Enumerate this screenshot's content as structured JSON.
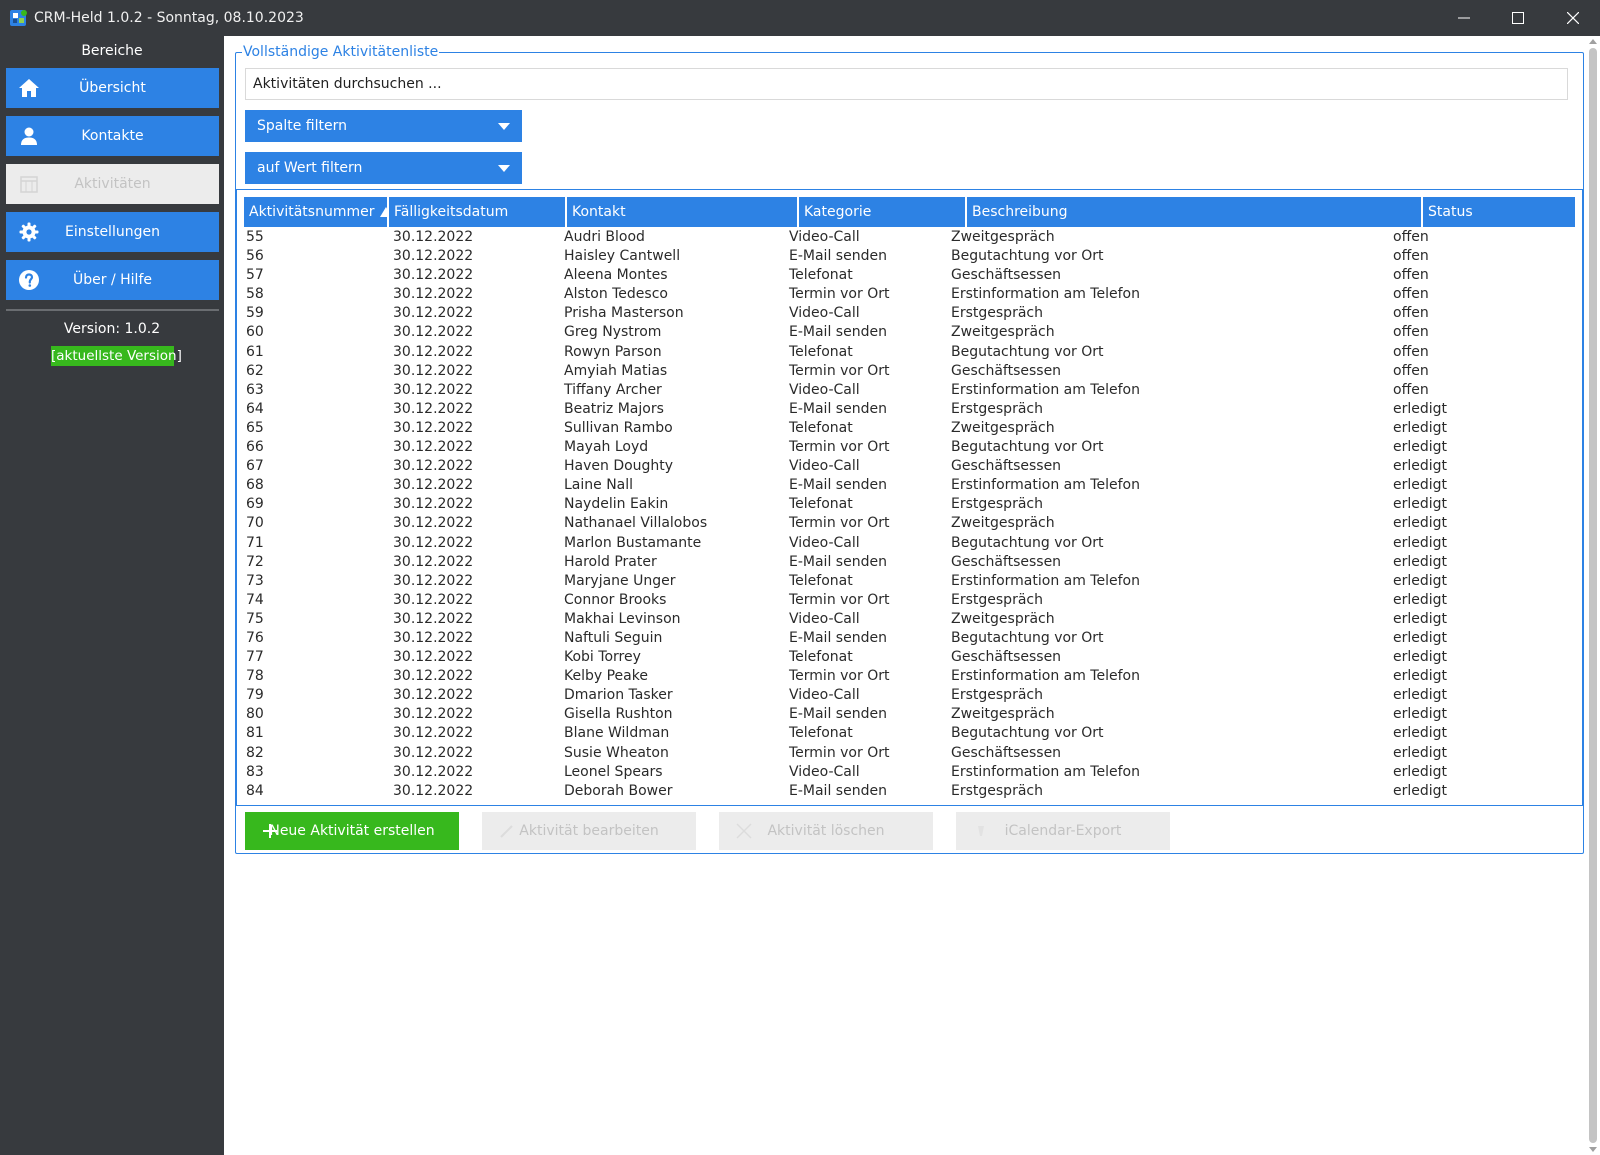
{
  "window": {
    "title": "CRM-Held 1.0.2 - Sonntag, 08.10.2023",
    "controls": [
      "minimize-icon",
      "maximize-icon",
      "close-icon"
    ]
  },
  "sidebar": {
    "section_title": "Bereiche",
    "items": [
      {
        "label": "Übersicht",
        "icon": "home-icon",
        "enabled": true
      },
      {
        "label": "Kontakte",
        "icon": "person-icon",
        "enabled": true
      },
      {
        "label": "Aktivitäten",
        "icon": "activities-icon",
        "enabled": false
      },
      {
        "label": "Einstellungen",
        "icon": "gear-icon",
        "enabled": true
      },
      {
        "label": "Über / Hilfe",
        "icon": "help-icon",
        "enabled": true
      }
    ],
    "version": "Version: 1.0.2",
    "version_badge": "[aktuellste Version]"
  },
  "main": {
    "group_title": "Vollständige Aktivitätenliste",
    "search_placeholder": "Aktivitäten durchsuchen ...",
    "filter_column": "Spalte filtern",
    "filter_value": "auf Wert filtern",
    "table": {
      "columns": [
        "Aktivitätsnummer",
        "Fälligkeitsdatum",
        "Kontakt",
        "Kategorie",
        "Beschreibung",
        "Status"
      ],
      "sorted_column": "Aktivitätsnummer",
      "sort_direction": "ascending",
      "rows": [
        [
          "55",
          "30.12.2022",
          "Audri Blood",
          "Video-Call",
          "Zweitgespräch",
          "offen"
        ],
        [
          "56",
          "30.12.2022",
          "Haisley Cantwell",
          "E-Mail senden",
          "Begutachtung vor Ort",
          "offen"
        ],
        [
          "57",
          "30.12.2022",
          "Aleena Montes",
          "Telefonat",
          "Geschäftsessen",
          "offen"
        ],
        [
          "58",
          "30.12.2022",
          "Alston Tedesco",
          "Termin vor Ort",
          "Erstinformation am Telefon",
          "offen"
        ],
        [
          "59",
          "30.12.2022",
          "Prisha Masterson",
          "Video-Call",
          "Erstgespräch",
          "offen"
        ],
        [
          "60",
          "30.12.2022",
          "Greg Nystrom",
          "E-Mail senden",
          "Zweitgespräch",
          "offen"
        ],
        [
          "61",
          "30.12.2022",
          "Rowyn Parson",
          "Telefonat",
          "Begutachtung vor Ort",
          "offen"
        ],
        [
          "62",
          "30.12.2022",
          "Amyiah Matias",
          "Termin vor Ort",
          "Geschäftsessen",
          "offen"
        ],
        [
          "63",
          "30.12.2022",
          "Tiffany Archer",
          "Video-Call",
          "Erstinformation am Telefon",
          "offen"
        ],
        [
          "64",
          "30.12.2022",
          "Beatriz Majors",
          "E-Mail senden",
          "Erstgespräch",
          "erledigt"
        ],
        [
          "65",
          "30.12.2022",
          "Sullivan Rambo",
          "Telefonat",
          "Zweitgespräch",
          "erledigt"
        ],
        [
          "66",
          "30.12.2022",
          "Mayah Loyd",
          "Termin vor Ort",
          "Begutachtung vor Ort",
          "erledigt"
        ],
        [
          "67",
          "30.12.2022",
          "Haven Doughty",
          "Video-Call",
          "Geschäftsessen",
          "erledigt"
        ],
        [
          "68",
          "30.12.2022",
          "Laine Nall",
          "E-Mail senden",
          "Erstinformation am Telefon",
          "erledigt"
        ],
        [
          "69",
          "30.12.2022",
          "Naydelin Eakin",
          "Telefonat",
          "Erstgespräch",
          "erledigt"
        ],
        [
          "70",
          "30.12.2022",
          "Nathanael Villalobos",
          "Termin vor Ort",
          "Zweitgespräch",
          "erledigt"
        ],
        [
          "71",
          "30.12.2022",
          "Marlon Bustamante",
          "Video-Call",
          "Begutachtung vor Ort",
          "erledigt"
        ],
        [
          "72",
          "30.12.2022",
          "Harold Prater",
          "E-Mail senden",
          "Geschäftsessen",
          "erledigt"
        ],
        [
          "73",
          "30.12.2022",
          "Maryjane Unger",
          "Telefonat",
          "Erstinformation am Telefon",
          "erledigt"
        ],
        [
          "74",
          "30.12.2022",
          "Connor Brooks",
          "Termin vor Ort",
          "Erstgespräch",
          "erledigt"
        ],
        [
          "75",
          "30.12.2022",
          "Makhai Levinson",
          "Video-Call",
          "Zweitgespräch",
          "erledigt"
        ],
        [
          "76",
          "30.12.2022",
          "Naftuli Seguin",
          "E-Mail senden",
          "Begutachtung vor Ort",
          "erledigt"
        ],
        [
          "77",
          "30.12.2022",
          "Kobi Torrey",
          "Telefonat",
          "Geschäftsessen",
          "erledigt"
        ],
        [
          "78",
          "30.12.2022",
          "Kelby Peake",
          "Termin vor Ort",
          "Erstinformation am Telefon",
          "erledigt"
        ],
        [
          "79",
          "30.12.2022",
          "Dmarion Tasker",
          "Video-Call",
          "Erstgespräch",
          "erledigt"
        ],
        [
          "80",
          "30.12.2022",
          "Gisella Rushton",
          "E-Mail senden",
          "Zweitgespräch",
          "erledigt"
        ],
        [
          "81",
          "30.12.2022",
          "Blane Wildman",
          "Telefonat",
          "Begutachtung vor Ort",
          "erledigt"
        ],
        [
          "82",
          "30.12.2022",
          "Susie Wheaton",
          "Termin vor Ort",
          "Geschäftsessen",
          "erledigt"
        ],
        [
          "83",
          "30.12.2022",
          "Leonel Spears",
          "Video-Call",
          "Erstinformation am Telefon",
          "erledigt"
        ],
        [
          "84",
          "30.12.2022",
          "Deborah Bower",
          "E-Mail senden",
          "Erstgespräch",
          "erledigt"
        ]
      ]
    },
    "actions": [
      {
        "label": "Neue Aktivität erstellen",
        "icon": "plus-icon",
        "enabled": true
      },
      {
        "label": "Aktivität bearbeiten",
        "icon": "pencil-icon",
        "enabled": false
      },
      {
        "label": "Aktivität löschen",
        "icon": "cross-icon",
        "enabled": false
      },
      {
        "label": "iCalendar-Export",
        "icon": "export-icon",
        "enabled": false
      }
    ]
  },
  "colors": {
    "titlebar": "#373a3e",
    "sidebar": "#373a3e",
    "accent": "#2d82e4",
    "success": "#37b81d",
    "disabled": "#ececec",
    "disabled_text": "#c3c3c3"
  }
}
